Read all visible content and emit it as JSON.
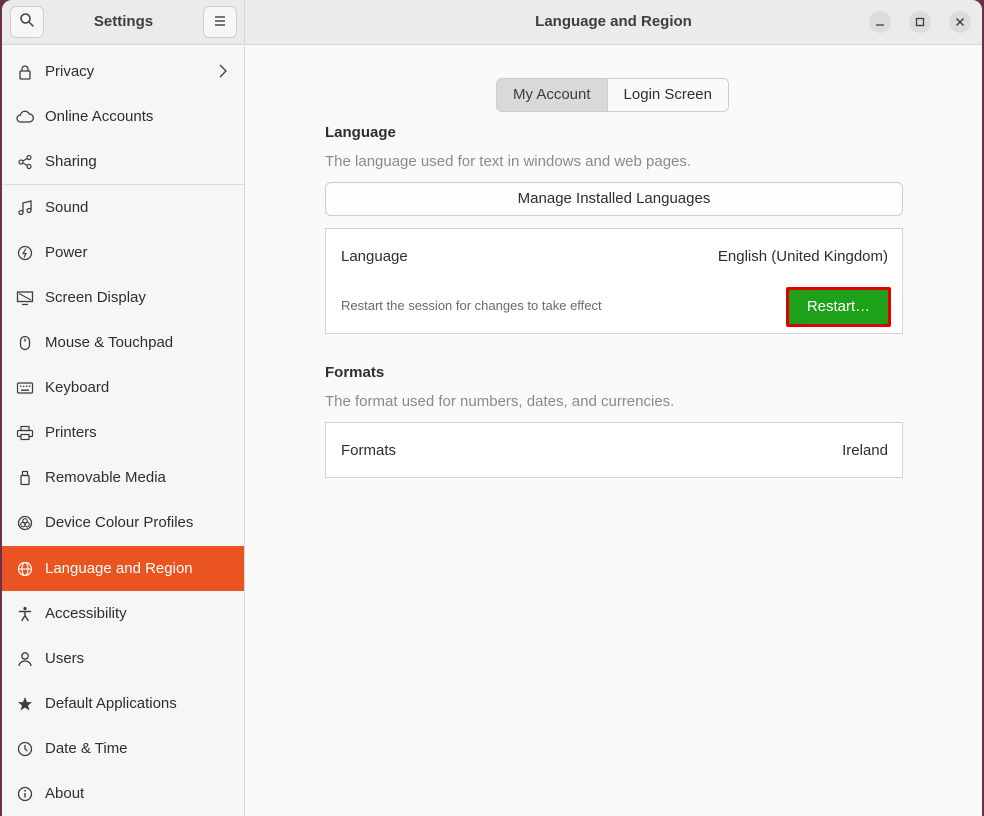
{
  "sidebar_title": "Settings",
  "window_title": "Language and Region",
  "sidebar": {
    "items": [
      {
        "label": "Privacy",
        "icon": "lock-icon"
      },
      {
        "label": "Online Accounts",
        "icon": "cloud-icon"
      },
      {
        "label": "Sharing",
        "icon": "share-icon"
      },
      {
        "label": "Sound",
        "icon": "music-note-icon"
      },
      {
        "label": "Power",
        "icon": "power-icon"
      },
      {
        "label": "Screen Display",
        "icon": "display-icon"
      },
      {
        "label": "Mouse & Touchpad",
        "icon": "mouse-icon"
      },
      {
        "label": "Keyboard",
        "icon": "keyboard-icon"
      },
      {
        "label": "Printers",
        "icon": "printer-icon"
      },
      {
        "label": "Removable Media",
        "icon": "removable-media-icon"
      },
      {
        "label": "Device Colour Profiles",
        "icon": "colour-profile-icon"
      },
      {
        "label": "Language and Region",
        "icon": "globe-icon",
        "active": true
      },
      {
        "label": "Accessibility",
        "icon": "accessibility-icon"
      },
      {
        "label": "Users",
        "icon": "user-icon"
      },
      {
        "label": "Default Applications",
        "icon": "star-icon"
      },
      {
        "label": "Date & Time",
        "icon": "clock-icon"
      },
      {
        "label": "About",
        "icon": "info-icon"
      }
    ]
  },
  "tabs": [
    "My Account",
    "Login Screen"
  ],
  "language": {
    "title": "Language",
    "subtitle": "The language used for text in windows and web pages.",
    "manage_button": "Manage Installed Languages",
    "row_label": "Language",
    "row_value": "English (United Kingdom)",
    "restart_note": "Restart the session for changes to take effect",
    "restart_button": "Restart…"
  },
  "formats": {
    "title": "Formats",
    "subtitle": "The format used for numbers, dates, and currencies.",
    "row_label": "Formats",
    "row_value": "Ireland"
  },
  "colors": {
    "accent": "#e95420",
    "restart_green": "#1da11a",
    "highlight_red": "#e00000"
  }
}
